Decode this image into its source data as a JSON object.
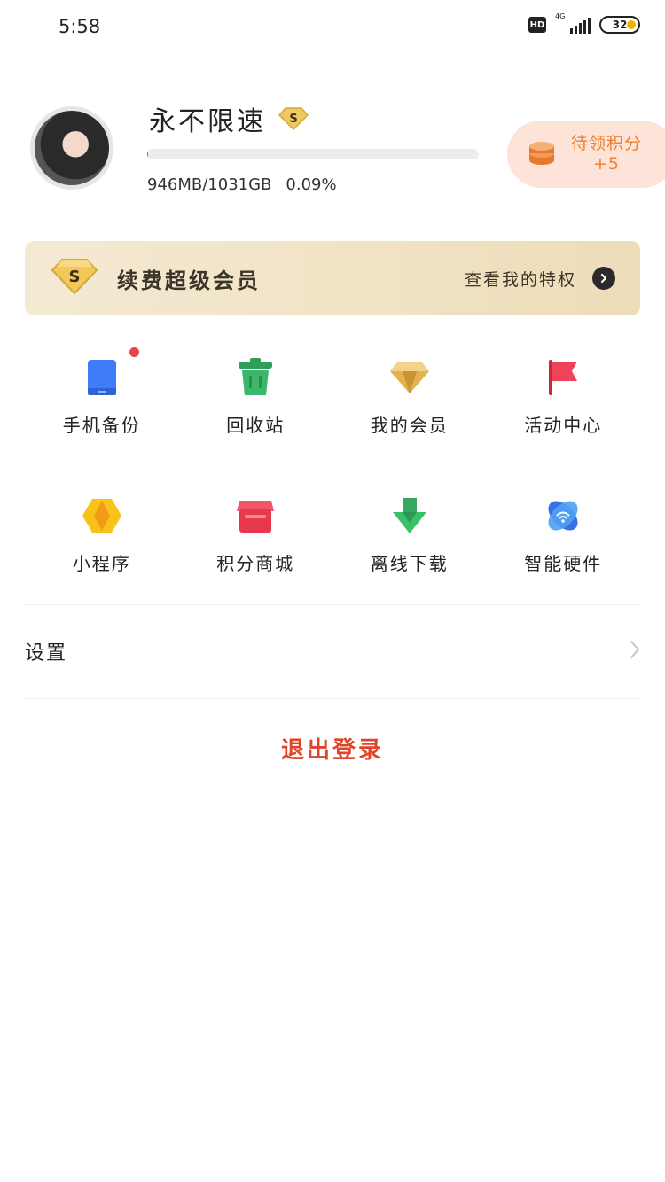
{
  "status_bar": {
    "time": "5:58",
    "hd_label": "HD",
    "network_label": "4G",
    "battery_level": "32"
  },
  "profile": {
    "username": "永不限速",
    "badge_icon": "svip-s-badge-icon",
    "quota_used_text": "946MB/1031GB",
    "quota_percent_text": "0.09%",
    "quota_fraction": 0.0009,
    "points": {
      "title": "待领积分",
      "value": "+5",
      "icon": "coin-stack-icon"
    }
  },
  "vip_banner": {
    "title": "续费超级会员",
    "link_label": "查看我的特权",
    "icon": "svip-diamond-icon"
  },
  "grid": [
    {
      "label": "手机备份",
      "icon": "phone-backup-icon",
      "has_dot": true
    },
    {
      "label": "回收站",
      "icon": "recycle-bin-icon",
      "has_dot": false
    },
    {
      "label": "我的会员",
      "icon": "diamond-icon",
      "has_dot": false
    },
    {
      "label": "活动中心",
      "icon": "flag-icon",
      "has_dot": false
    },
    {
      "label": "小程序",
      "icon": "mini-program-icon",
      "has_dot": false
    },
    {
      "label": "积分商城",
      "icon": "store-icon",
      "has_dot": false
    },
    {
      "label": "离线下载",
      "icon": "download-arrow-icon",
      "has_dot": false
    },
    {
      "label": "智能硬件",
      "icon": "smart-hardware-icon",
      "has_dot": false
    }
  ],
  "settings": {
    "label": "设置"
  },
  "logout": {
    "label": "退出登录"
  },
  "colors": {
    "accent_blue": "#3f7cf7",
    "logout_red": "#e0452a",
    "points_orange": "#f0822e",
    "banner_gold": "#eddcb8"
  }
}
